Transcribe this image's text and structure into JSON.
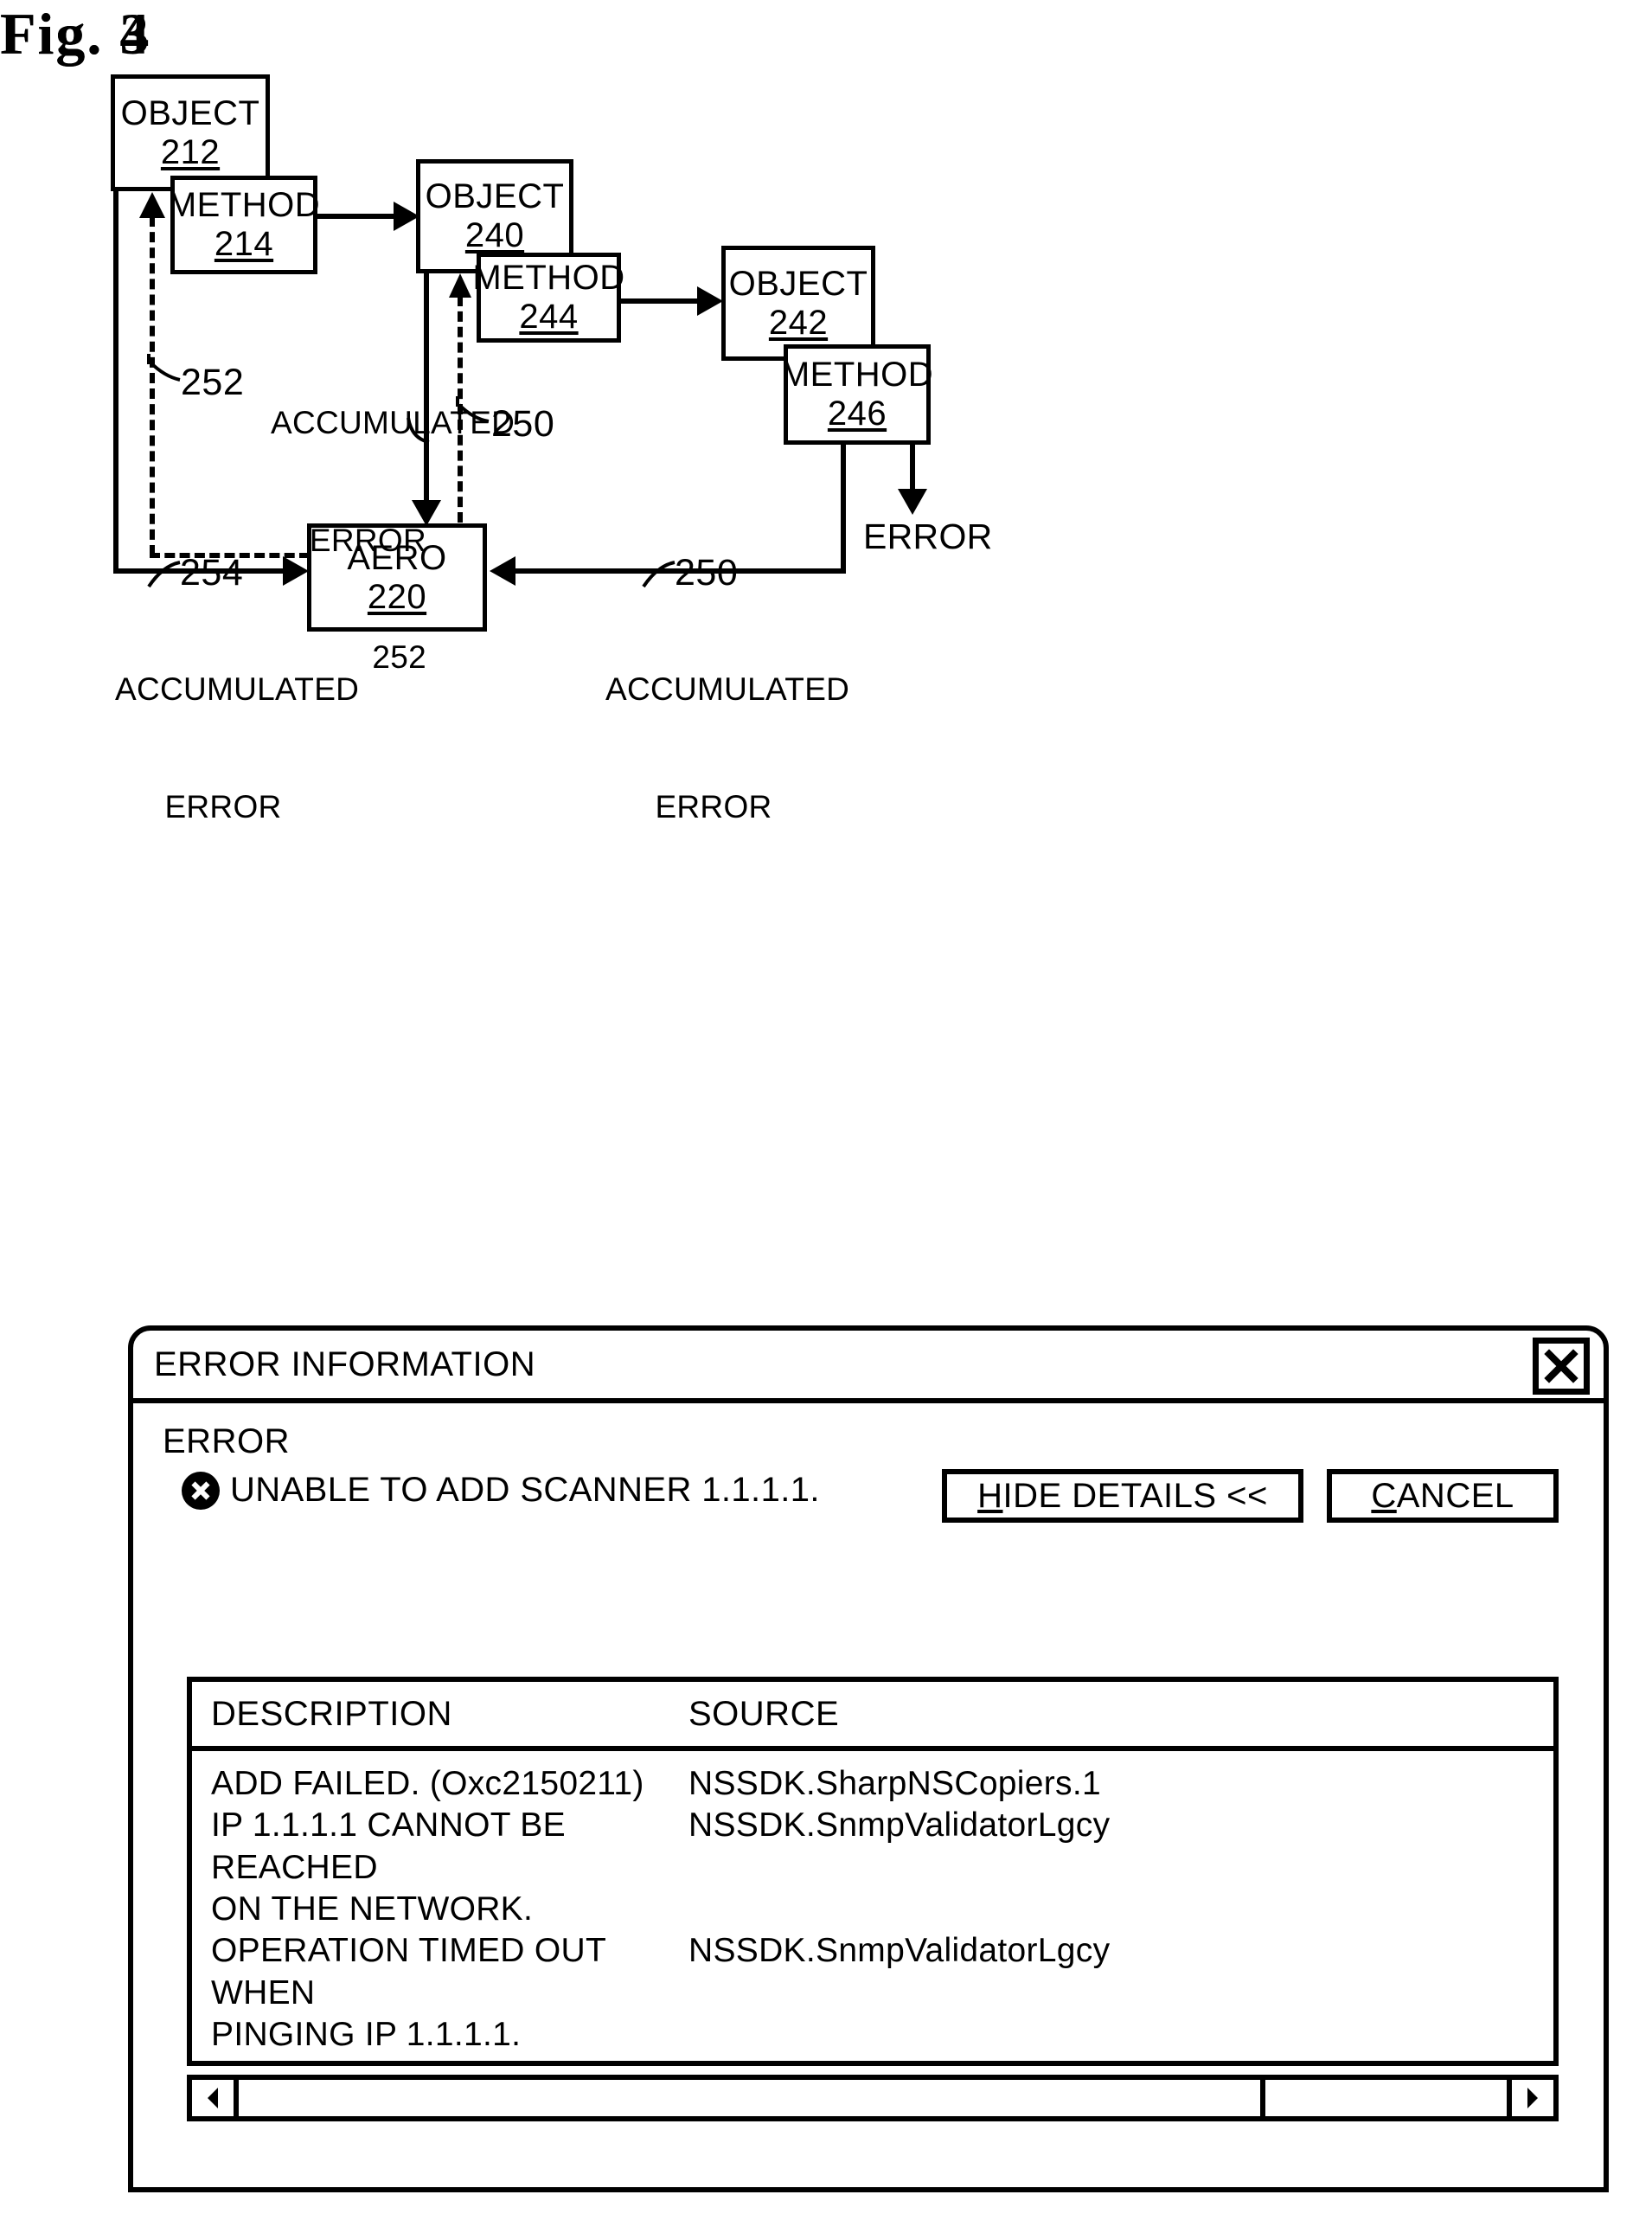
{
  "figures": {
    "fig3_caption": "Fig. 3",
    "fig4_caption": "Fig. 4"
  },
  "fig3": {
    "nodes": [
      {
        "title": "OBJECT",
        "number": "212"
      },
      {
        "title": "METHOD",
        "number": "214"
      },
      {
        "title": "OBJECT",
        "number": "240"
      },
      {
        "title": "METHOD",
        "number": "244"
      },
      {
        "title": "OBJECT",
        "number": "242"
      },
      {
        "title": "METHOD",
        "number": "246"
      },
      {
        "title": "AERO",
        "number": "220"
      }
    ],
    "labels": {
      "accumulated_error_mid_line1": "ACCUMULATED",
      "accumulated_error_mid_line2": "ERROR",
      "accumulated_error_mid_num": "252",
      "accumulated_error_left_line1": "ACCUMULATED",
      "accumulated_error_left_line2": "ERROR",
      "accumulated_error_right_line1": "ACCUMULATED",
      "accumulated_error_right_line2": "ERROR",
      "error_out": "ERROR"
    },
    "ref_numbers": {
      "ref_252_left": "252",
      "ref_250_mid": "250",
      "ref_254": "254",
      "ref_250_right": "250"
    }
  },
  "fig4": {
    "window": {
      "title": "ERROR INFORMATION",
      "close_icon": "close-icon"
    },
    "error": {
      "heading": "ERROR",
      "icon": "error-circle-x-icon",
      "message": "UNABLE TO ADD SCANNER 1.1.1.1."
    },
    "buttons": {
      "hide_details_mnemonic": "H",
      "hide_details_rest": "IDE DETAILS <<",
      "cancel_mnemonic": "C",
      "cancel_rest": "ANCEL"
    },
    "details_table": {
      "columns": [
        "DESCRIPTION",
        "SOURCE"
      ],
      "rows": [
        {
          "description": "ADD FAILED. (Oxc2150211)",
          "source": "NSSDK.SharpNSCopiers.1"
        },
        {
          "description": "IP 1.1.1.1 CANNOT BE REACHED\nON THE NETWORK.",
          "source": "NSSDK.SnmpValidatorLgcy"
        },
        {
          "description": "OPERATION TIMED OUT WHEN\nPINGING IP 1.1.1.1.",
          "source": "NSSDK.SnmpValidatorLgcy"
        }
      ]
    },
    "scrollbar": {
      "left_arrow_icon": "chevron-left-icon",
      "right_arrow_icon": "chevron-right-icon"
    }
  }
}
